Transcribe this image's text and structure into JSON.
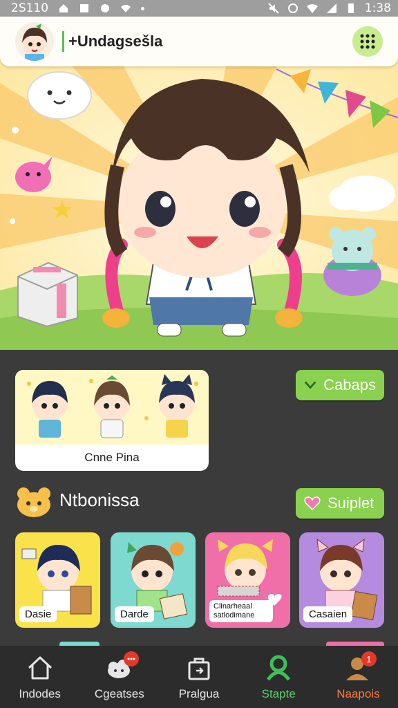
{
  "status_bar": {
    "time_left": "2S110",
    "time_right": "1:38"
  },
  "header": {
    "title": "+Undagsešla"
  },
  "featured": {
    "caption": "Cnne Pina"
  },
  "buttons": {
    "primary_label": "Cabaps",
    "secondary_label": "Suiplet"
  },
  "section": {
    "title": "Ntbonissa"
  },
  "characters": [
    {
      "name": "Dasie",
      "bg": "#f9e24a"
    },
    {
      "name": "Darde",
      "bg": "#7ed9d0"
    },
    {
      "name": "Clinarheaal satlodimane",
      "bg": "#f06fa8"
    },
    {
      "name": "Casaien",
      "bg": "#b58be0"
    }
  ],
  "bottom_nav": [
    {
      "label": "Indodes",
      "icon": "home-icon"
    },
    {
      "label": "Cgeatses",
      "icon": "chat-cloud-icon",
      "badge": ""
    },
    {
      "label": "Pralgua",
      "icon": "bag-icon"
    },
    {
      "label": "Stapte",
      "icon": "person-icon"
    },
    {
      "label": "Naapois",
      "icon": "profile-icon",
      "badge": "1"
    }
  ],
  "colors": {
    "accent": "#8ad14f",
    "active": "#5fcf6a",
    "alert": "#ff7a3a",
    "badge": "#e23a2a"
  }
}
